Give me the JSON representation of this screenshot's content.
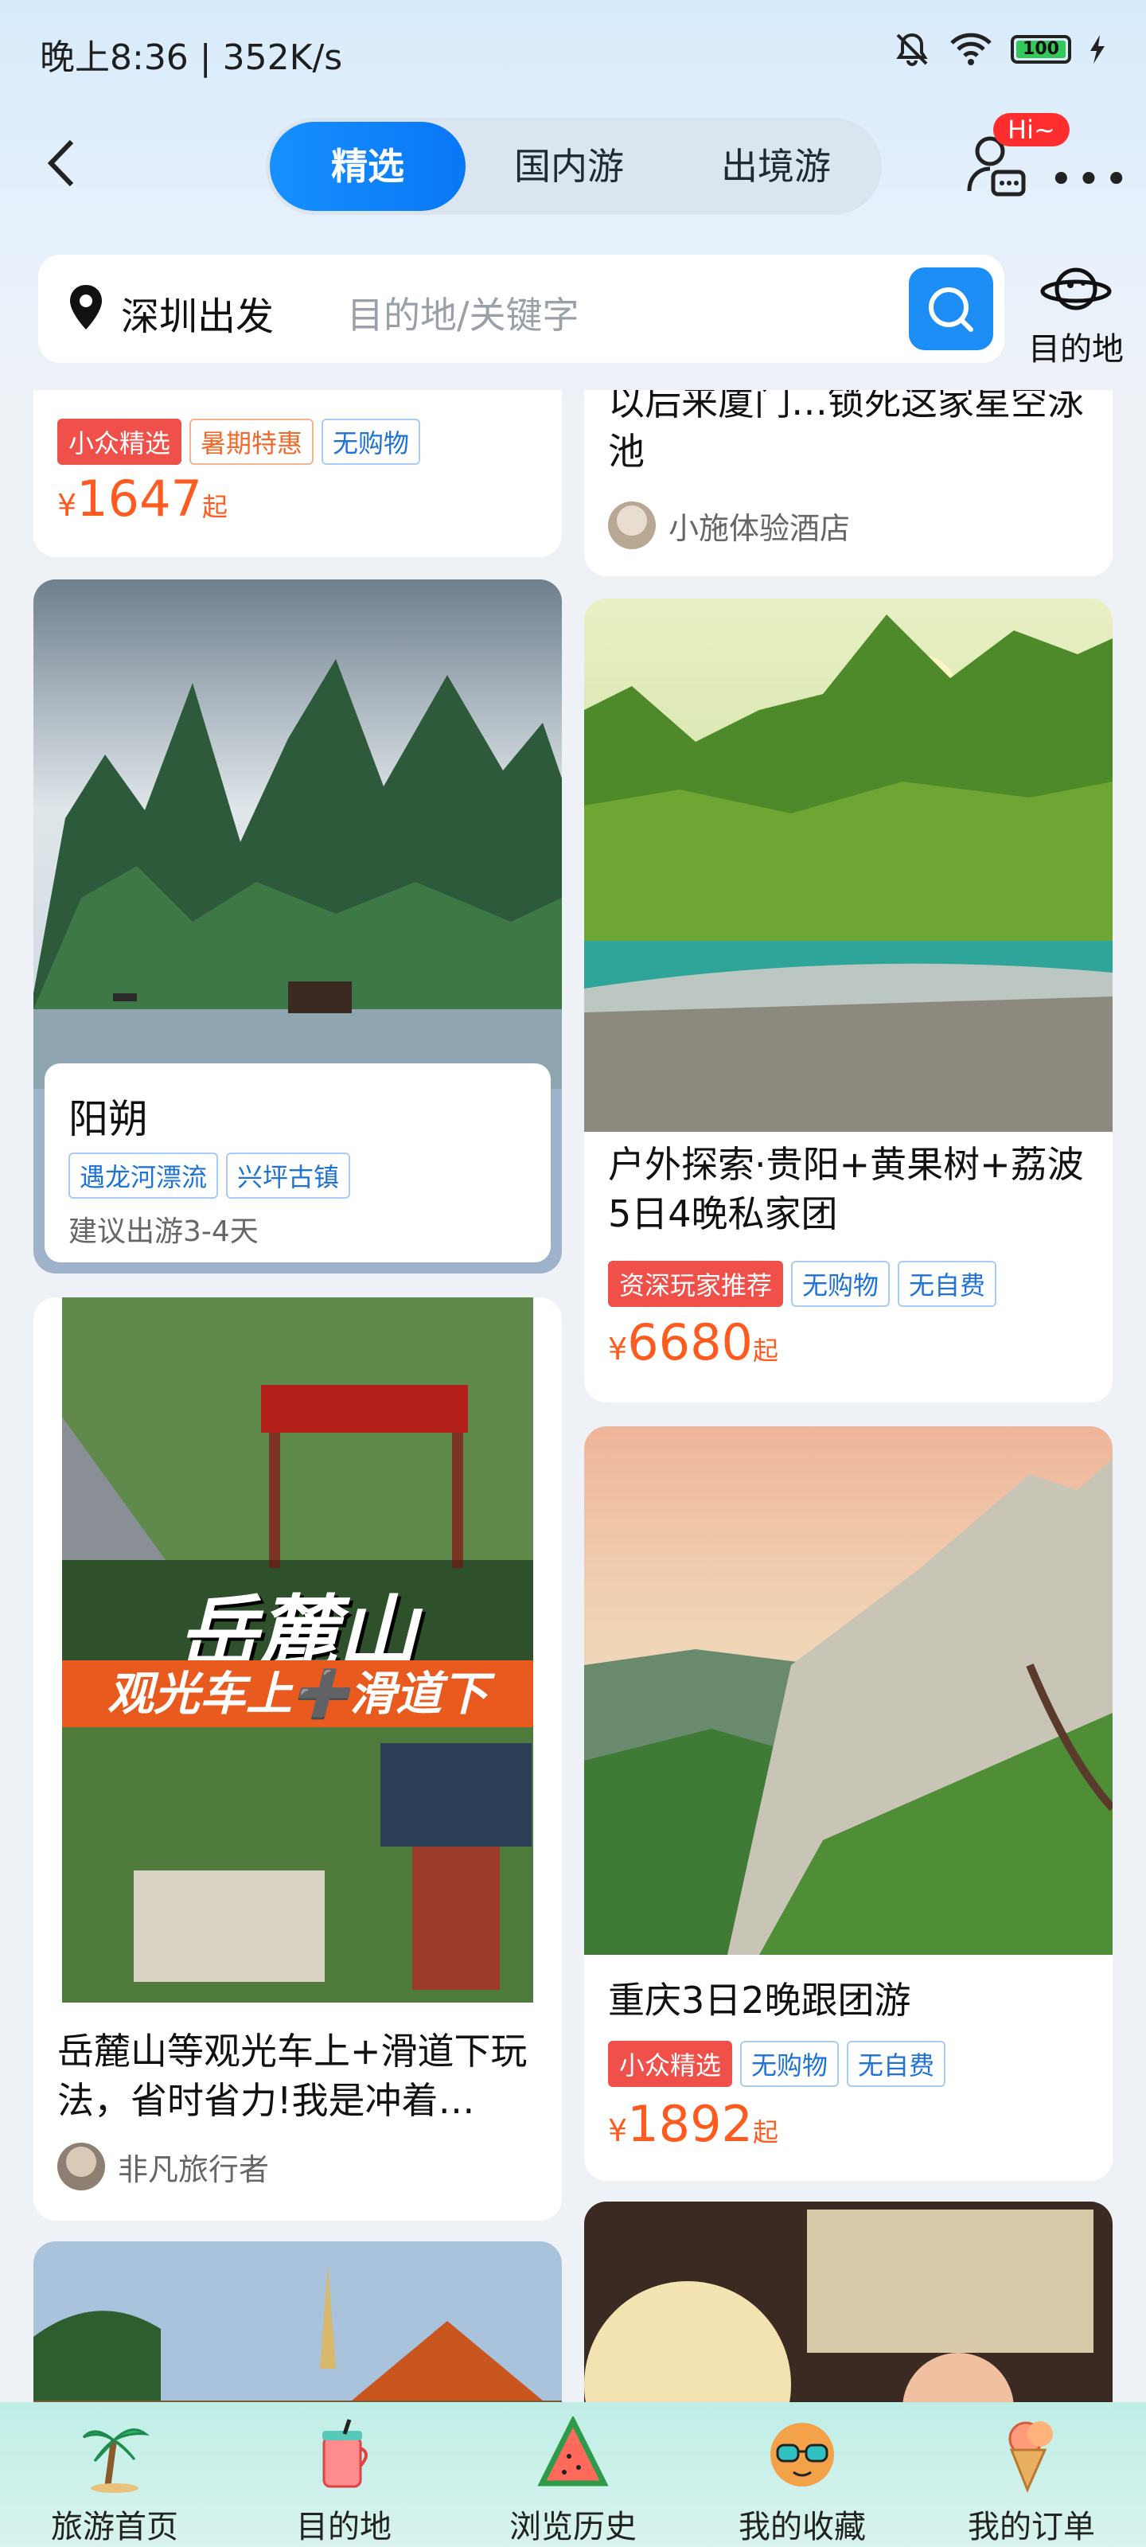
{
  "status_bar": {
    "time_speed": "晚上8:36 | 352K/s",
    "battery": "100"
  },
  "header": {
    "tabs": [
      "精选",
      "国内游",
      "出境游"
    ],
    "hi_badge": "Hi~"
  },
  "search": {
    "origin": "深圳出发",
    "placeholder": "目的地/关键字",
    "destination_label": "目的地"
  },
  "cards": {
    "c1": {
      "tags": [
        "小众精选",
        "暑期特惠",
        "无购物"
      ],
      "price_symbol": "¥",
      "price": "1647",
      "price_suffix": "起"
    },
    "c2": {
      "title_tail": "以后来厦门…锁死这家星空泳池",
      "author": "小施体验酒店"
    },
    "c3": {
      "name": "阳朔",
      "tags": [
        "遇龙河漂流",
        "兴坪古镇"
      ],
      "note": "建议出游3-4天"
    },
    "c4": {
      "title": "户外探索·贵阳+黄果树+荔波5日4晚私家团",
      "tags": [
        "资深玩家推荐",
        "无购物",
        "无自费"
      ],
      "price_symbol": "¥",
      "price": "6680",
      "price_suffix": "起"
    },
    "c5": {
      "poster_title": "岳麓山",
      "poster_sub": "观光车上➕滑道下",
      "title": "岳麓山等观光车上+滑道下玩法，省时省力!我是冲着…",
      "author": "非凡旅行者"
    },
    "c6": {
      "title": "重庆3日2晚跟团游",
      "tags": [
        "小众精选",
        "无购物",
        "无自费"
      ],
      "price_symbol": "¥",
      "price": "1892",
      "price_suffix": "起"
    }
  },
  "bottom_nav": [
    "旅游首页",
    "目的地",
    "浏览历史",
    "我的收藏",
    "我的订单"
  ]
}
